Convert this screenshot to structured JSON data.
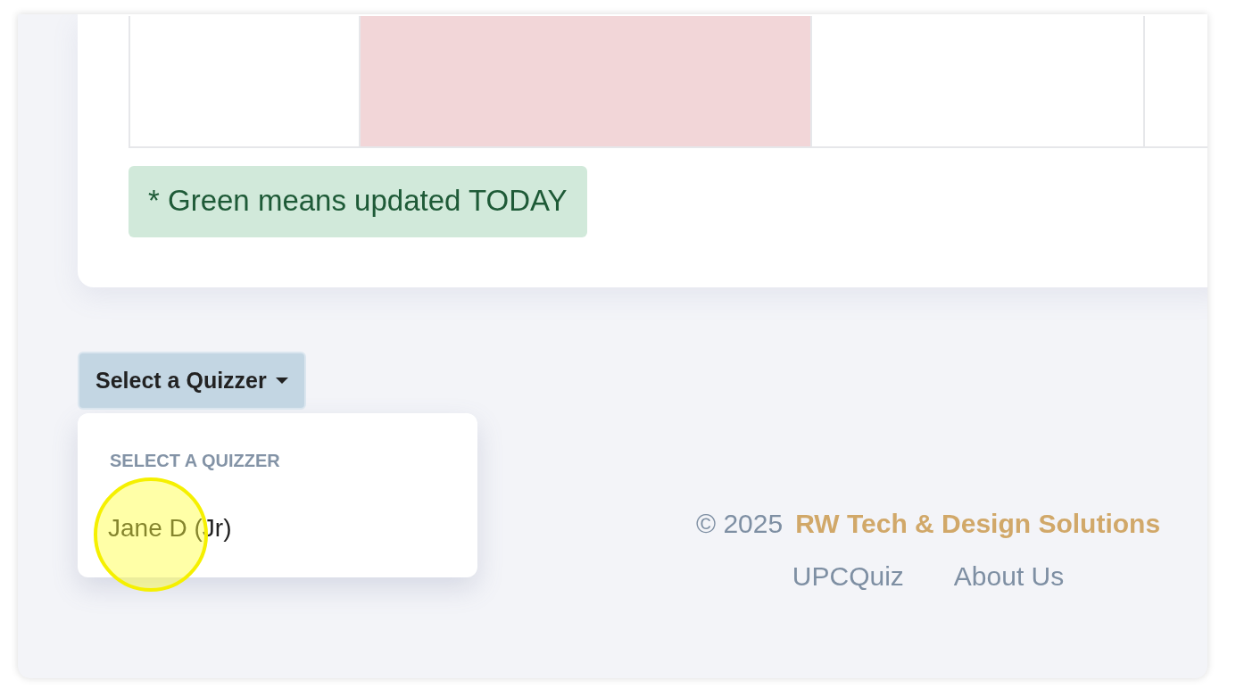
{
  "table": {
    "cells": [
      {
        "color": "#ffffff"
      },
      {
        "color": "#f2d6d8"
      },
      {
        "color": "#ffffff"
      },
      {
        "color": "#ffffff"
      }
    ]
  },
  "notice": "* Green means updated TODAY",
  "quizzer_dropdown": {
    "label": "Select a Quizzer",
    "expanded": true,
    "menu_header": "SELECT A QUIZZER",
    "items": [
      {
        "label": "Jane D (Jr)",
        "hovered": true
      }
    ]
  },
  "footer": {
    "copyright": "© 2025",
    "company": "RW Tech & Design Solutions",
    "links": [
      "UPCQuiz",
      "About Us"
    ]
  }
}
